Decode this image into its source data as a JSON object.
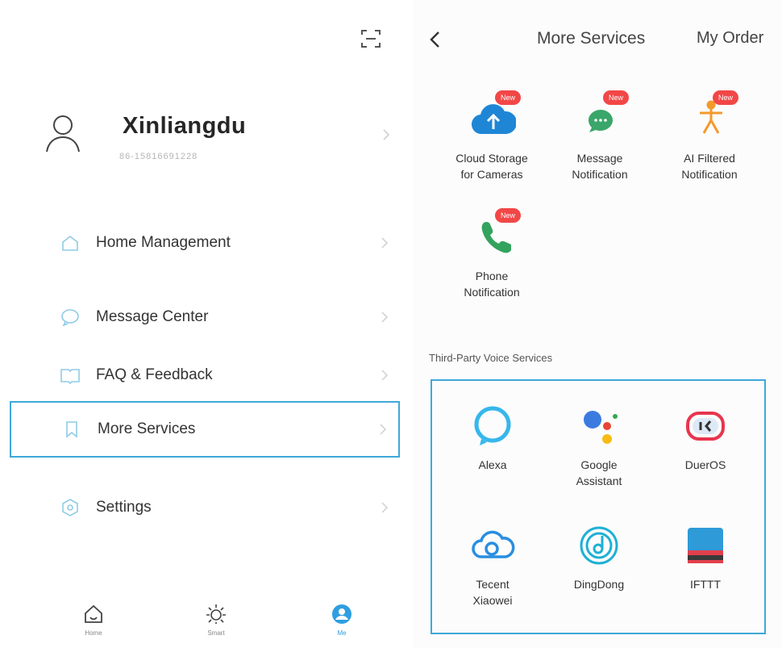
{
  "left": {
    "profile": {
      "name": "Xinliangdu",
      "phone": "86-15816691228"
    },
    "menu": [
      {
        "label": "Home Management"
      },
      {
        "label": "Message Center"
      },
      {
        "label": "FAQ & Feedback"
      },
      {
        "label": "More Services"
      },
      {
        "label": "Settings"
      }
    ],
    "tabs": [
      {
        "label": "Home"
      },
      {
        "label": "Smart"
      },
      {
        "label": "Me"
      }
    ]
  },
  "right": {
    "header": {
      "title": "More Services",
      "order": "My Order"
    },
    "new_badge": "New",
    "services": [
      {
        "label": "Cloud Storage\nfor Cameras",
        "icon": "cloud-upload-icon"
      },
      {
        "label": "Message\nNotification",
        "icon": "chat-bubble-icon"
      },
      {
        "label": "AI Filtered\nNotification",
        "icon": "person-filter-icon"
      },
      {
        "label": "Phone\nNotification",
        "icon": "phone-icon"
      }
    ],
    "voice_section_title": "Third-Party Voice Services",
    "voice_services": [
      {
        "label": "Alexa",
        "icon": "alexa-icon"
      },
      {
        "label": "Google\nAssistant",
        "icon": "google-assistant-icon"
      },
      {
        "label": "DuerOS",
        "icon": "dueros-icon"
      },
      {
        "label": "Tecent\nXiaowei",
        "icon": "xiaowei-cloud-icon"
      },
      {
        "label": "DingDong",
        "icon": "dingdong-icon"
      },
      {
        "label": "IFTTT",
        "icon": "ifttt-icon"
      }
    ]
  },
  "colors": {
    "accent": "#3fa8d8",
    "badge": "#f24747",
    "active_tab": "#2f9ee0"
  }
}
